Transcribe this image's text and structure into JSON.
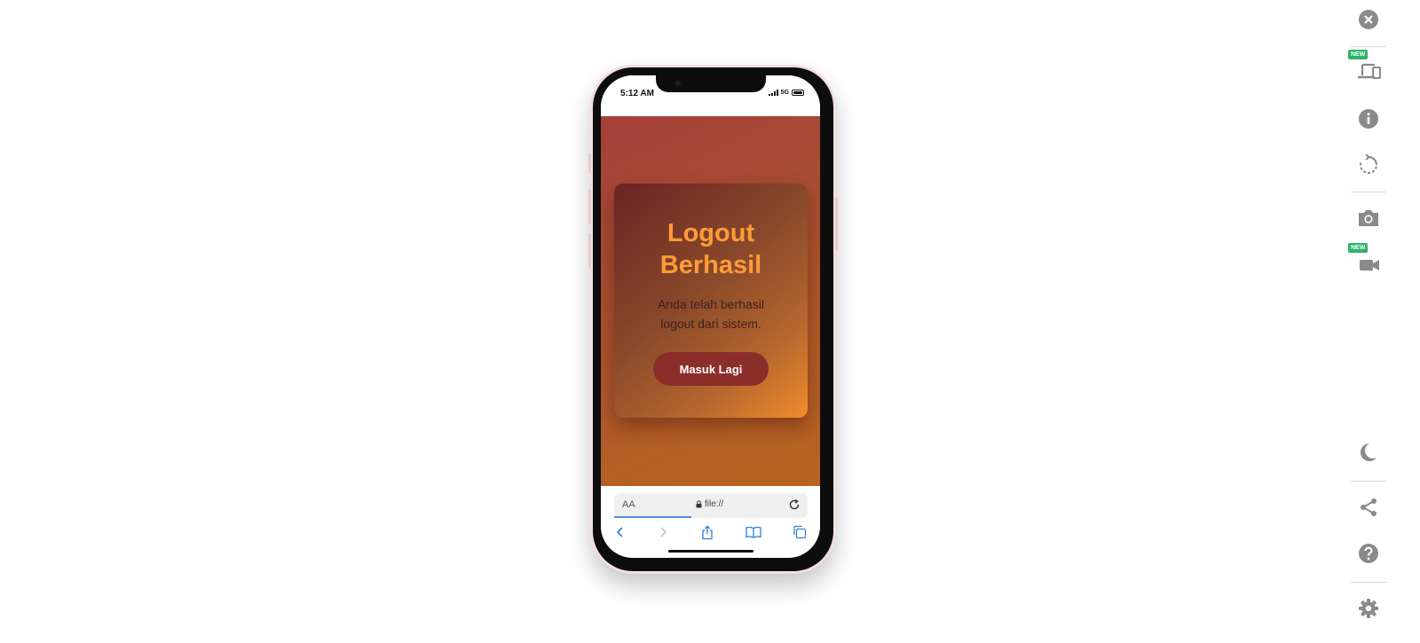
{
  "phone": {
    "status": {
      "time": "5:12 AM",
      "network": "5G"
    },
    "card": {
      "title": "Logout\nBerhasil",
      "message": "Anda telah berhasil\nlogout dari sistem.",
      "button_label": "Masuk Lagi"
    },
    "browser": {
      "text_size_label": "AA",
      "url": "file://",
      "toolbar_icons": [
        "back-icon",
        "forward-icon",
        "share-icon",
        "bookmarks-icon",
        "tabs-icon"
      ]
    }
  },
  "sidebar": {
    "badge_new": "NEW",
    "items": [
      "close-icon",
      "devices-icon",
      "info-icon",
      "rotate-icon",
      "screenshot-icon",
      "video-record-icon",
      "dark-mode-icon",
      "share-icon",
      "help-icon",
      "settings-icon"
    ]
  },
  "colors": {
    "title": "#ff9b3a",
    "button": "#8b2e2a",
    "badge": "#2eb367",
    "sidebar_icon": "#8a8a8a"
  }
}
